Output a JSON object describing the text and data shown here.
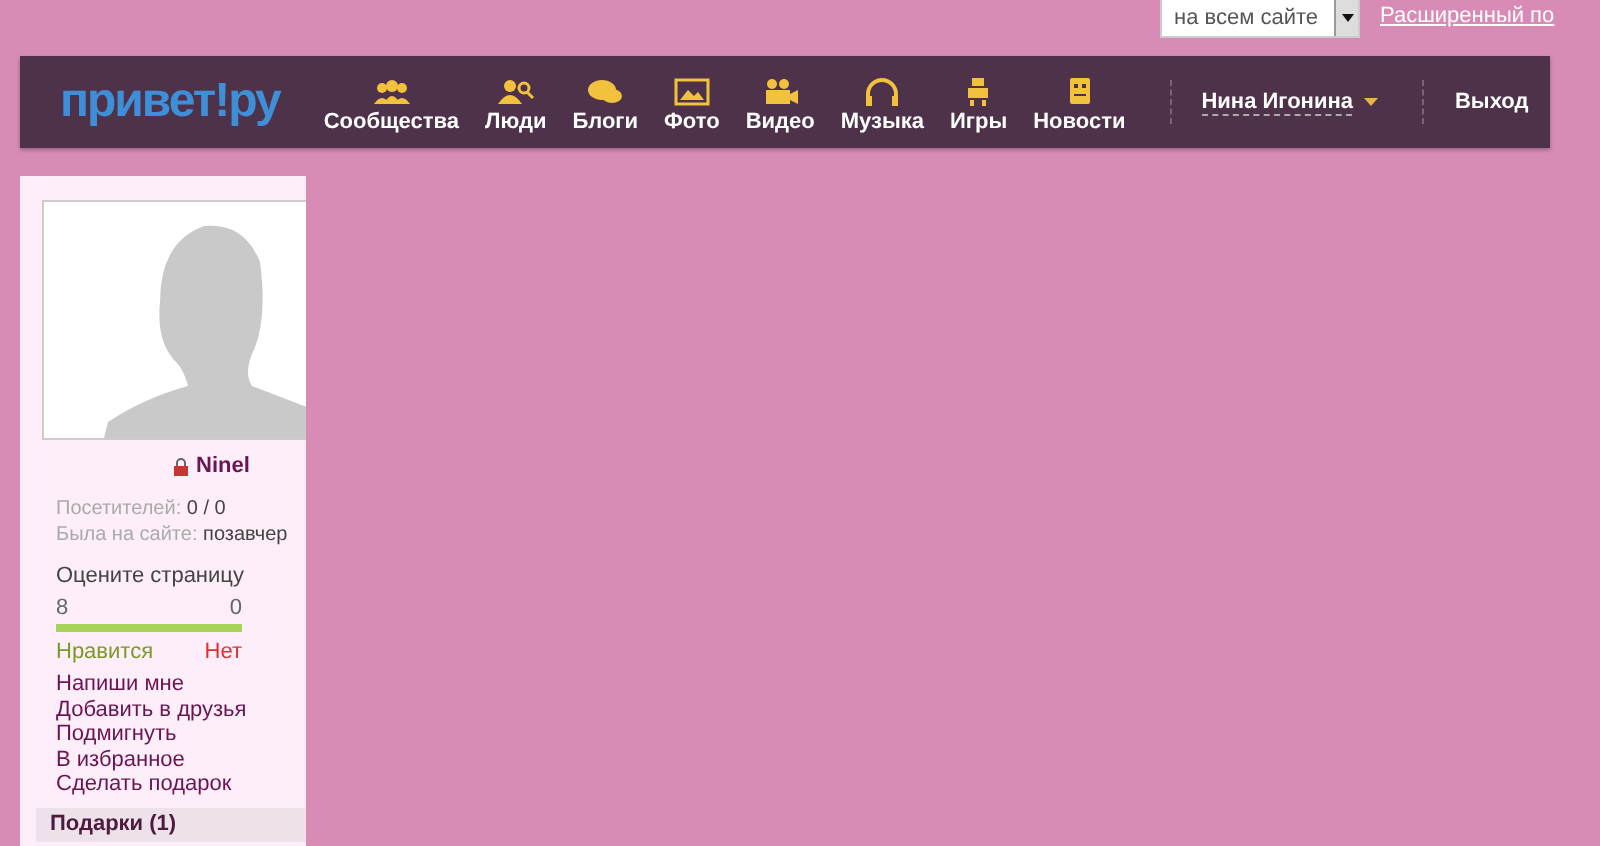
{
  "search": {
    "scope": "на всем сайте",
    "advanced_link": "Расширенный по"
  },
  "logo": "привет!ру",
  "nav": [
    {
      "label": "Сообщества"
    },
    {
      "label": "Люди"
    },
    {
      "label": "Блоги"
    },
    {
      "label": "Фото"
    },
    {
      "label": "Видео"
    },
    {
      "label": "Музыка"
    },
    {
      "label": "Игры"
    },
    {
      "label": "Новости"
    }
  ],
  "user_menu": "Нина Игонина",
  "logout": "Выход",
  "profile": {
    "name": "Ninel",
    "stats": [
      {
        "label": "Посетителей:",
        "value": "0 / 0"
      },
      {
        "label": "Была на сайте:",
        "value": "позавчер"
      }
    ],
    "rating": {
      "title": "Оцените страницу",
      "likes": "8",
      "dislikes": "0",
      "level": 1,
      "like_label": "Нравится",
      "dislike_label": "Нет"
    },
    "actions": [
      "Напиши мне",
      "Добавить в друзья",
      "Подмигнуть",
      "В избранное",
      "Сделать подарок"
    ],
    "section": "Подарки (1)"
  }
}
